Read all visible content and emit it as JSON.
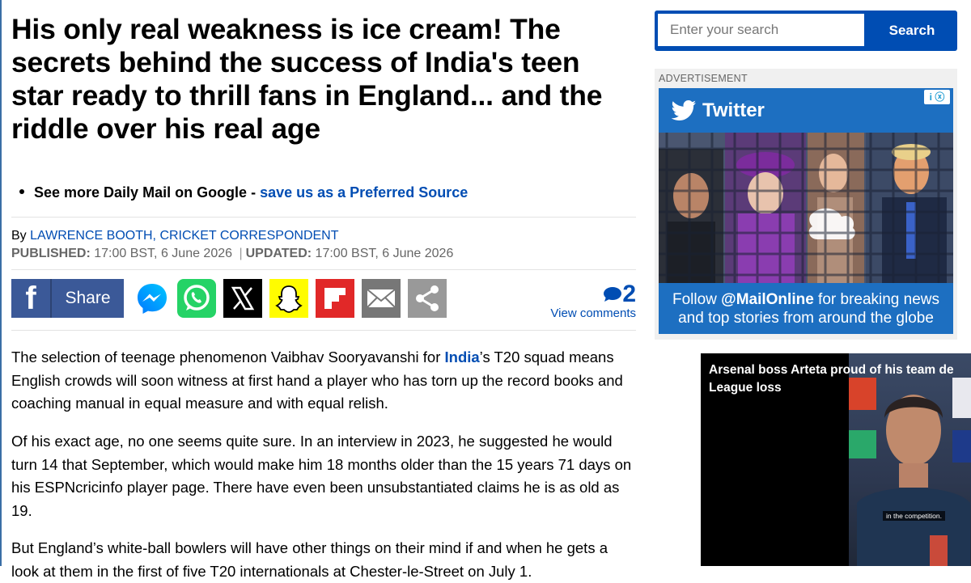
{
  "article": {
    "headline": "His only real weakness is ice cream! The secrets behind the success of India's teen star ready to thrill fans in England... and the riddle over his real age",
    "preferred_prefix": "See more Daily Mail on Google - ",
    "preferred_link": "save us as a Preferred Source",
    "byline_prefix": "By ",
    "byline_author": "LAWRENCE BOOTH, CRICKET CORRESPONDENT",
    "published_label": "PUBLISHED:",
    "published_value": " 17:00 BST, 6 June 2026 ",
    "separator": "|",
    "updated_label": "UPDATED:",
    "updated_value": " 17:00 BST, 6 June 2026",
    "share_label": "Share",
    "comment_count": "2",
    "view_comments": "View comments",
    "para1_a": "The selection of teenage phenomenon Vaibhav Sooryavanshi for ",
    "para1_link": "India",
    "para1_b": "’s T20 squad means English crowds will soon witness at first hand a player who has torn up the record books and coaching manual in equal measure and with equal relish.",
    "para2": "Of his exact age, no one seems quite sure. In an interview in 2023, he suggested he would turn 14 that September, which would make him 18 months older than the 15 years 71 days on his ESPNcricinfo player page. There have even been unsubstantiated claims he is as old as 19.",
    "para3": "But England’s white-ball bowlers will have other things on their mind if and when he gets a look at them in the first of five T20 internationals at Chester-le-Street on July 1."
  },
  "search": {
    "placeholder": "Enter your search",
    "button_label": "Search"
  },
  "ad": {
    "label": "ADVERTISEMENT",
    "brand": "Twitter",
    "text_prefix": "Follow ",
    "handle": "@MailOnline",
    "text_suffix": " for breaking news and top stories from around the globe"
  },
  "video": {
    "title_line1": "Arsenal boss Arteta proud of his team de",
    "title_line2": "League loss",
    "caption": "in the competition."
  },
  "colors": {
    "link_blue": "#004db3",
    "facebook": "#3b5998",
    "twitter_ad": "#1d6fc1"
  }
}
